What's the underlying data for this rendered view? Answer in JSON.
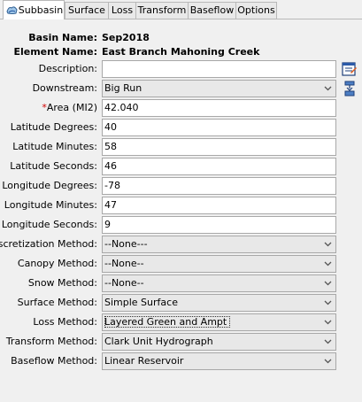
{
  "tabs": [
    "Subbasin",
    "Surface",
    "Loss",
    "Transform",
    "Baseflow",
    "Options"
  ],
  "header": {
    "basin_label": "Basin Name:",
    "basin_value": "Sep2018",
    "element_label": "Element Name:",
    "element_value": "East Branch Mahoning Creek"
  },
  "fields": {
    "description": {
      "label": "Description:",
      "value": ""
    },
    "downstream": {
      "label": "Downstream:",
      "value": "Big Run"
    },
    "area": {
      "required_mark": "*",
      "label": "Area (MI2)",
      "value": "42.040"
    },
    "lat_deg": {
      "label": "Latitude Degrees:",
      "value": "40"
    },
    "lat_min": {
      "label": "Latitude Minutes:",
      "value": "58"
    },
    "lat_sec": {
      "label": "Latitude Seconds:",
      "value": "46"
    },
    "lon_deg": {
      "label": "Longitude Degrees:",
      "value": "-78"
    },
    "lon_min": {
      "label": "Longitude Minutes:",
      "value": "47"
    },
    "lon_sec": {
      "label": "Longitude Seconds:",
      "value": "9"
    },
    "discretization": {
      "label": "Discretization Method:",
      "value": "--None---"
    },
    "canopy": {
      "label": "Canopy Method:",
      "value": "--None--"
    },
    "snow": {
      "label": "Snow Method:",
      "value": "--None--"
    },
    "surface": {
      "label": "Surface Method:",
      "value": "Simple Surface"
    },
    "loss": {
      "label": "Loss Method:",
      "value": "Layered Green and Ampt"
    },
    "transform": {
      "label": "Transform Method:",
      "value": "Clark Unit Hydrograph"
    },
    "baseflow": {
      "label": "Baseflow Method:",
      "value": "Linear Reservoir"
    }
  },
  "icons": {
    "subbasin_tab": "subbasin-icon",
    "description_button": "edit-description-icon",
    "downstream_button": "select-downstream-icon"
  },
  "colors": {
    "required": "#d00000",
    "panel": "#f0f0f0",
    "field_border": "#a8a8a8"
  }
}
